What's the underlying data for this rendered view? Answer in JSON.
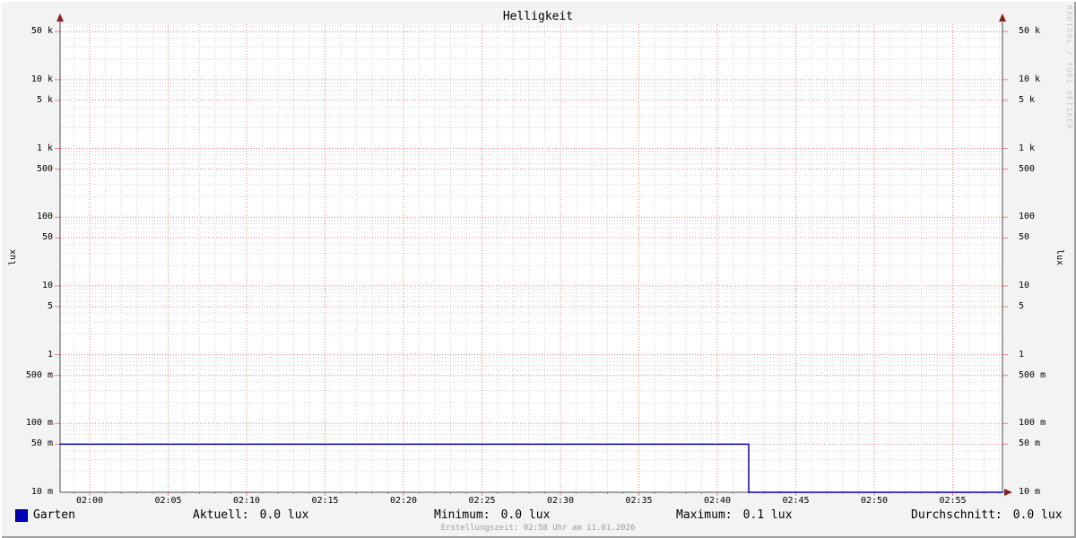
{
  "title": "Helligkeit",
  "watermark": "RRDTOOL / TOBI OETIKER",
  "footer": "Erstellungszeit: 02:58 Uhr am 11.01.2026",
  "legend": {
    "label": "Garten",
    "color": "#0000bb"
  },
  "stats": [
    {
      "label": "Aktuell:",
      "value": "0.0 lux"
    },
    {
      "label": "Minimum:",
      "value": "0.0 lux"
    },
    {
      "label": "Maximum:",
      "value": "0.1 lux"
    },
    {
      "label": "Durchschnitt:",
      "value": "0.0 lux"
    }
  ],
  "chart_data": {
    "type": "line",
    "title": "Helligkeit",
    "ylabel_left": "lux",
    "ylabel_right": "lux",
    "y_scale": "logarithmic",
    "ylim": [
      0.01,
      64000
    ],
    "grid": true,
    "legend_position": "bottom-left",
    "y_ticks": [
      {
        "v": 0.01,
        "label": "10 m"
      },
      {
        "v": 0.05,
        "label": "50 m"
      },
      {
        "v": 0.1,
        "label": "100 m"
      },
      {
        "v": 0.5,
        "label": "500 m"
      },
      {
        "v": 1,
        "label": "1"
      },
      {
        "v": 5,
        "label": "5"
      },
      {
        "v": 10,
        "label": "10"
      },
      {
        "v": 50,
        "label": "50"
      },
      {
        "v": 100,
        "label": "100"
      },
      {
        "v": 500,
        "label": "500"
      },
      {
        "v": 1000,
        "label": "1 k"
      },
      {
        "v": 5000,
        "label": "5 k"
      },
      {
        "v": 10000,
        "label": "10 k"
      },
      {
        "v": 50000,
        "label": "50 k"
      }
    ],
    "x_range": [
      "01:58",
      "02:58"
    ],
    "x_major_ticks": [
      "02:00",
      "02:05",
      "02:10",
      "02:15",
      "02:20",
      "02:25",
      "02:30",
      "02:35",
      "02:40",
      "02:45",
      "02:50",
      "02:55"
    ],
    "x_minor_step_minutes": 1,
    "series": [
      {
        "name": "Garten",
        "color": "#0000bb",
        "points": [
          [
            "01:58",
            0.05
          ],
          [
            "02:42",
            0.05
          ],
          [
            "02:42",
            0.0
          ],
          [
            "02:58",
            0.0
          ]
        ]
      }
    ],
    "colors": {
      "background": "#f3f3f3",
      "canvas": "#ffffff",
      "grid_minor": "#d2d2d2",
      "grid_major": "#f08080",
      "minor_tick": "#9a9a9a",
      "axis": "#4d4d4d",
      "arrow": "#8b2020",
      "font": "#000000",
      "footer_text": "#9b9b9b",
      "watermark_text": "#c6c6c6"
    }
  }
}
